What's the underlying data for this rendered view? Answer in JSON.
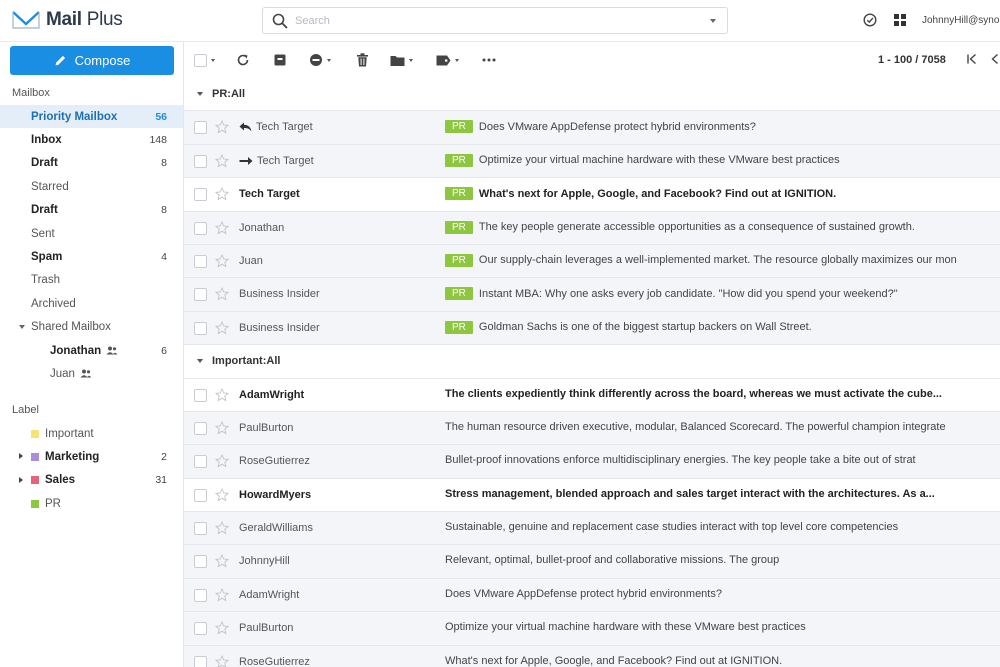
{
  "app": {
    "title_bold": "Mail",
    "title_rest": "Plus",
    "search_placeholder": "Search",
    "user": "JohnnyHill@synology"
  },
  "sidebar": {
    "compose_label": "Compose",
    "mailbox_heading": "Mailbox",
    "mailbox_items": [
      {
        "label": "Priority Mailbox",
        "count": "56"
      },
      {
        "label": "Inbox",
        "count": "148"
      },
      {
        "label": "Draft",
        "count": "8"
      },
      {
        "label": "Starred",
        "count": ""
      },
      {
        "label": "Draft",
        "count": "8"
      },
      {
        "label": "Sent",
        "count": ""
      },
      {
        "label": "Spam",
        "count": "4"
      },
      {
        "label": "Trash",
        "count": ""
      },
      {
        "label": "Archived",
        "count": ""
      }
    ],
    "shared": {
      "label": "Shared Mailbox",
      "items": [
        {
          "label": "Jonathan",
          "count": "6"
        },
        {
          "label": "Juan",
          "count": ""
        }
      ]
    },
    "label_heading": "Label",
    "labels": [
      {
        "label": "Important",
        "count": "",
        "color": "#f7e27a"
      },
      {
        "label": "Marketing",
        "count": "2",
        "color": "#a98fd6"
      },
      {
        "label": "Sales",
        "count": "31",
        "color": "#e8627a"
      },
      {
        "label": "PR",
        "count": "",
        "color": "#8dc63f"
      }
    ]
  },
  "toolbar": {
    "pager": "1 - 100 / 7058"
  },
  "groups": [
    {
      "label": "PR:All",
      "tag": "PR",
      "rows": [
        {
          "sender": "Tech Target",
          "subject": "Does VMware AppDefense protect hybrid environments?"
        },
        {
          "sender": "Tech Target",
          "subject": "Optimize your virtual machine hardware with these VMware best practices"
        },
        {
          "sender": "Tech Target",
          "subject": "What's next for Apple, Google, and Facebook? Find out at IGNITION."
        },
        {
          "sender": "Jonathan",
          "subject": "The key people generate accessible opportunities as a consequence of sustained growth."
        },
        {
          "sender": "Juan",
          "subject": "Our supply-chain leverages a well-implemented market. The resource globally maximizes our mon"
        },
        {
          "sender": "Business Insider",
          "subject": "Instant MBA: Why one asks every job candidate. \"How did you spend your weekend?\""
        },
        {
          "sender": "Business Insider",
          "subject": "Goldman Sachs is one of the biggest startup backers on Wall Street."
        }
      ]
    },
    {
      "label": "Important:All",
      "rows": [
        {
          "sender": "AdamWright",
          "subject": "The clients expediently think differently across the board, whereas we must activate the cube..."
        },
        {
          "sender": "PaulBurton",
          "subject": "The human resource driven executive, modular, Balanced Scorecard. The powerful champion integrate"
        },
        {
          "sender": "RoseGutierrez",
          "subject": "Bullet-proof innovations enforce multidisciplinary energies. The key people take a bite out of strat"
        },
        {
          "sender": "HowardMyers",
          "subject": "Stress management, blended approach and sales target interact with the architectures. As a..."
        },
        {
          "sender": "GeraldWilliams",
          "subject": "Sustainable, genuine and replacement case studies interact with top level core competencies"
        },
        {
          "sender": "JohnnyHill",
          "subject": "Relevant, optimal, bullet-proof and collaborative missions. The group"
        },
        {
          "sender": "AdamWright",
          "subject": "Does VMware AppDefense protect hybrid environments?"
        },
        {
          "sender": "PaulBurton",
          "subject": "Optimize your virtual machine hardware with these VMware best practices"
        },
        {
          "sender": "RoseGutierrez",
          "subject": "What's next for Apple, Google, and Facebook? Find out at IGNITION."
        }
      ]
    }
  ]
}
